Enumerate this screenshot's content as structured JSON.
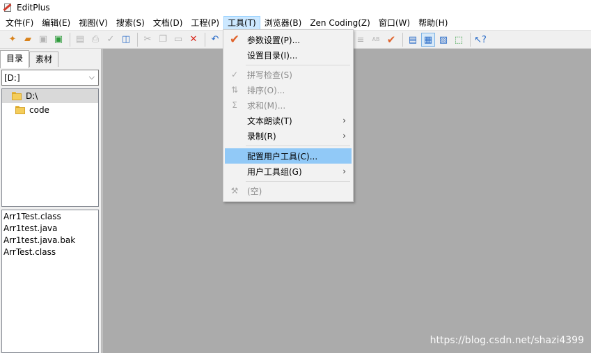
{
  "window": {
    "title": "EditPlus"
  },
  "menubar": {
    "items": [
      {
        "label": "文件(F)"
      },
      {
        "label": "编辑(E)"
      },
      {
        "label": "视图(V)"
      },
      {
        "label": "搜索(S)"
      },
      {
        "label": "文档(D)"
      },
      {
        "label": "工程(P)"
      },
      {
        "label": "工具(T)"
      },
      {
        "label": "浏览器(B)"
      },
      {
        "label": "Zen Coding(Z)"
      },
      {
        "label": "窗口(W)"
      },
      {
        "label": "帮助(H)"
      }
    ],
    "active_index": 6
  },
  "toolbar": {
    "icons": [
      "new-file-icon",
      "open-folder-icon",
      "save-icon",
      "save-all-icon",
      "print-preview-icon",
      "print-icon",
      "spell-check-icon",
      "browser-preview-icon",
      "cut-icon",
      "copy-icon",
      "paste-icon",
      "delete-icon",
      "undo-icon",
      "sort-icon",
      "word-count-icon",
      "check-icon",
      "output-window-icon",
      "directory-window-icon",
      "cliptext-window-icon",
      "full-screen-icon",
      "context-help-icon"
    ]
  },
  "left_panel": {
    "tabs": [
      {
        "label": "目录"
      },
      {
        "label": "素材"
      }
    ],
    "drive": "[D:]",
    "tree": [
      {
        "label": "D:\\"
      },
      {
        "label": "code"
      }
    ],
    "files": [
      {
        "name": "Arr1Test.class"
      },
      {
        "name": "Arr1test.java"
      },
      {
        "name": "Arr1test.java.bak"
      },
      {
        "name": "ArrTest.class"
      }
    ]
  },
  "tools_menu": {
    "items": [
      {
        "label": "参数设置(P)...",
        "icon": "check-icon",
        "enabled": true
      },
      {
        "label": "设置目录(I)...",
        "enabled": true
      },
      {
        "label": "拼写检查(S)",
        "icon": "spell-check-icon",
        "enabled": false
      },
      {
        "label": "排序(O)...",
        "icon": "sort-icon",
        "enabled": false
      },
      {
        "label": "求和(M)...",
        "icon": "sum-icon",
        "enabled": false
      },
      {
        "label": "文本朗读(T)",
        "submenu": true,
        "enabled": true
      },
      {
        "label": "录制(R)",
        "submenu": true,
        "enabled": true
      },
      {
        "label": "配置用户工具(C)...",
        "enabled": true,
        "highlighted": true
      },
      {
        "label": "用户工具组(G)",
        "submenu": true,
        "enabled": true
      },
      {
        "label": "(空)",
        "icon": "wrench-icon",
        "enabled": false
      }
    ],
    "submenu_glyph": "›"
  },
  "watermark": "https://blog.csdn.net/shazi4399",
  "colors": {
    "workspace": "#ababab",
    "menu_highlight": "#91c9f7",
    "menubar_active": "#cce8ff"
  }
}
